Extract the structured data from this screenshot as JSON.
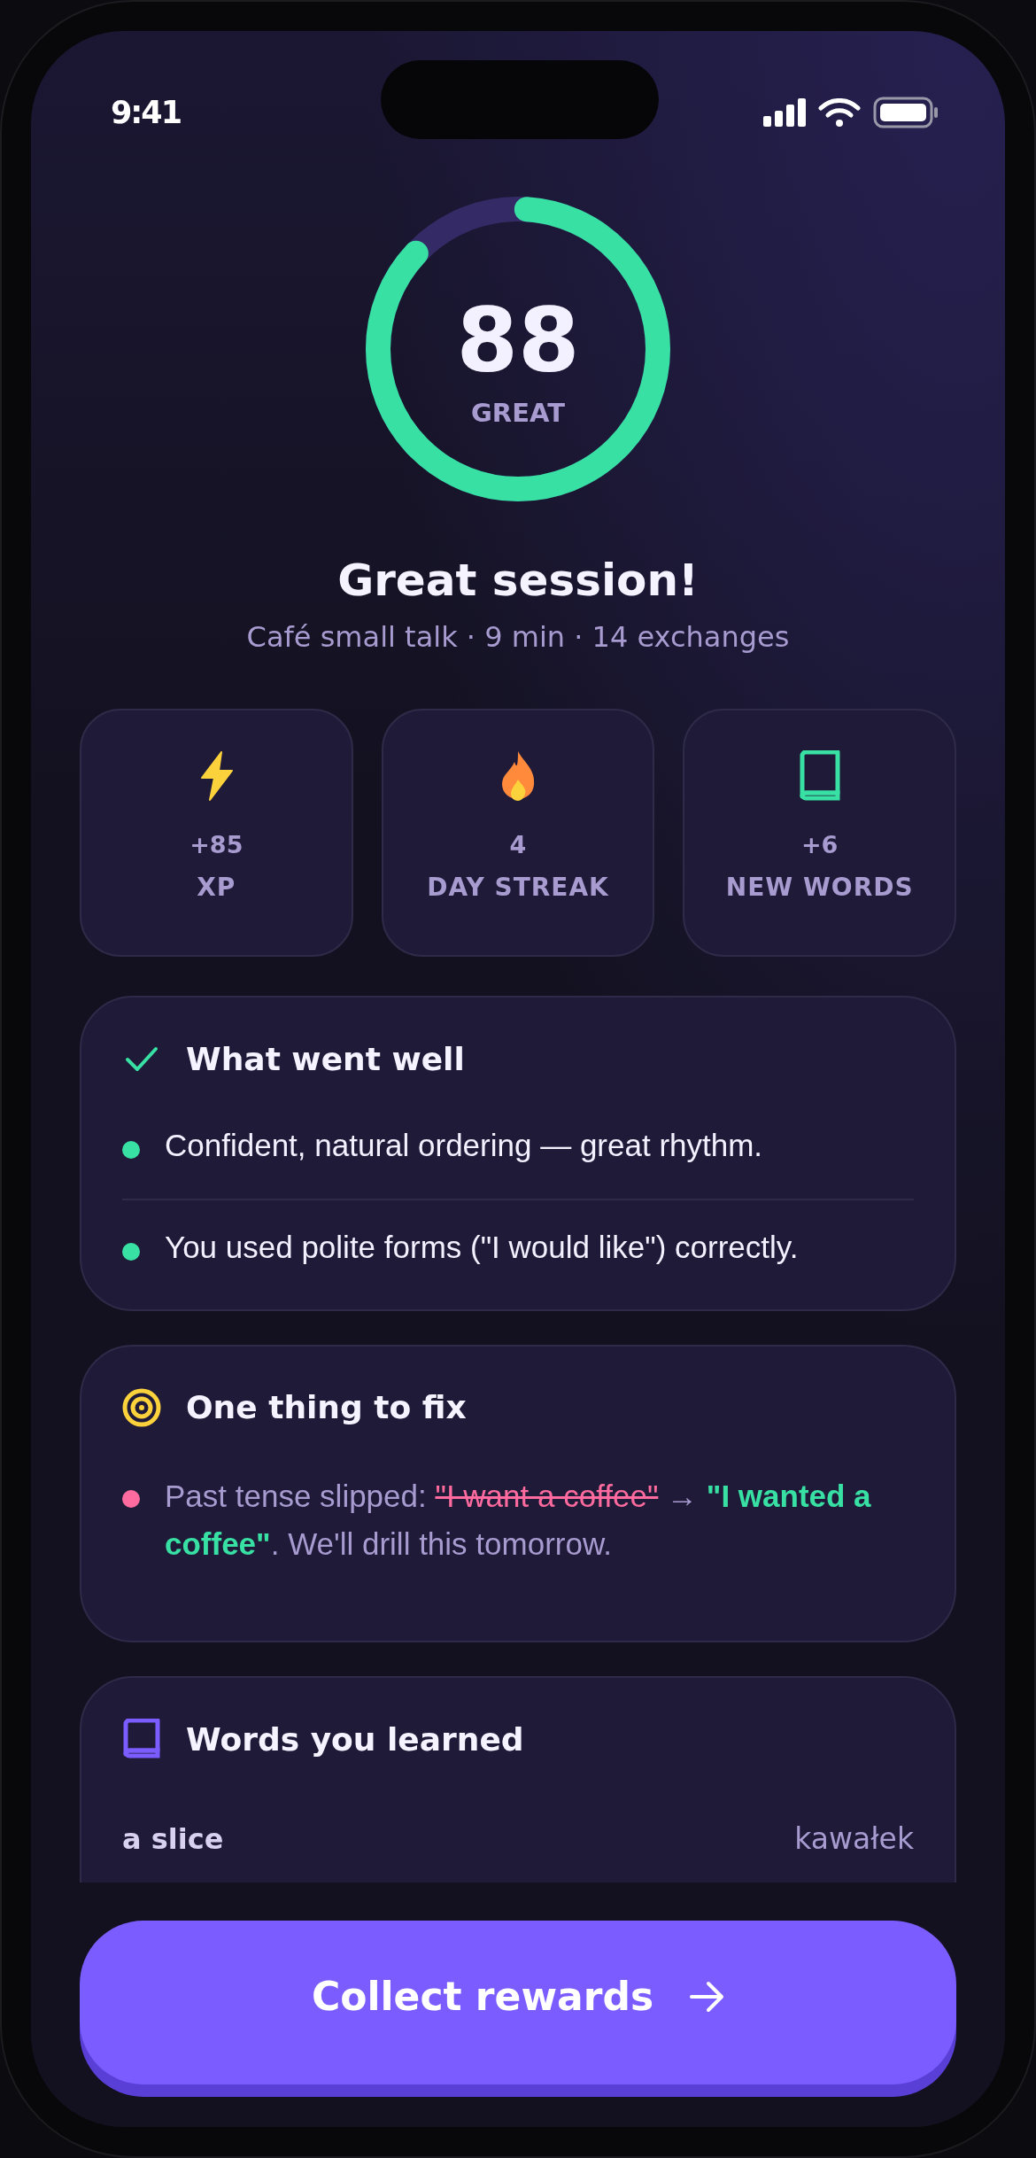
{
  "status_bar": {
    "time": "9:41"
  },
  "score": {
    "value": "88",
    "label": "GREAT",
    "level": 0.88
  },
  "title": "Great session!",
  "subtitle": "Café small talk · 9 min · 14 exchanges",
  "stats": [
    {
      "kind": "xp",
      "value": "+85",
      "label": "XP"
    },
    {
      "kind": "streak",
      "value": "4",
      "label": "DAY STREAK"
    },
    {
      "kind": "words",
      "value": "+6",
      "label": "NEW WORDS"
    }
  ],
  "sections": [
    {
      "kind": "well",
      "title": "What went well",
      "items": [
        {
          "text": "Confident, natural ordering — great rhythm."
        },
        {
          "text": "You used polite forms (\"I would like\") correctly."
        }
      ]
    },
    {
      "kind": "fix",
      "title": "One thing to fix",
      "items": [
        {
          "before": "Past tense slipped: ",
          "wrong": "\"I want a coffee\"",
          "arrow": "→",
          "right": "\"I wanted a coffee\"",
          "after": ". We'll drill this tomorrow."
        }
      ]
    },
    {
      "kind": "words",
      "title": "Words you learned",
      "words": [
        {
          "term": "a slice",
          "translation": "kawałek"
        }
      ]
    }
  ],
  "button": {
    "label": "Collect rewards"
  }
}
